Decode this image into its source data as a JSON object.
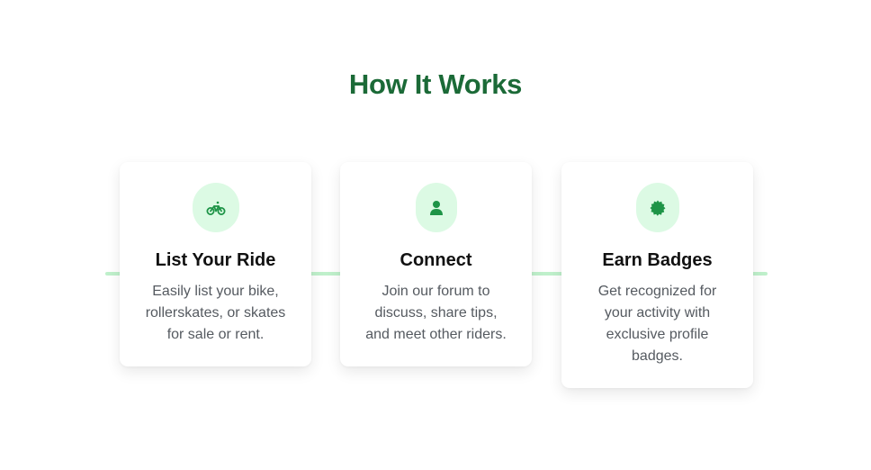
{
  "section": {
    "title": "How It Works"
  },
  "colors": {
    "title": "#1b6a37",
    "accent_icon": "#1e9447",
    "icon_bg": "#dcfae4",
    "connector": "#bff0cb"
  },
  "steps": [
    {
      "icon": "bicycle-icon",
      "title": "List Your Ride",
      "description": "Easily list your bike, rollerskates, or skates for sale or rent."
    },
    {
      "icon": "user-icon",
      "title": "Connect",
      "description": "Join our forum to discuss, share tips, and meet other riders."
    },
    {
      "icon": "badge-icon",
      "title": "Earn Badges",
      "description": "Get recognized for your activity with exclusive profile badges."
    }
  ]
}
